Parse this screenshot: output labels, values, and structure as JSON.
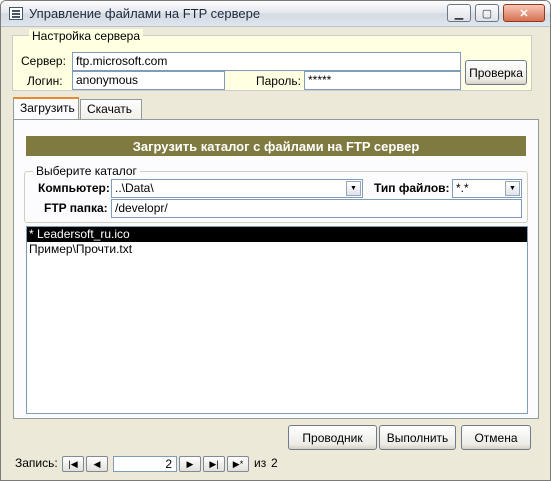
{
  "window": {
    "title": "Управление файлами на FTP сервере"
  },
  "settings": {
    "legend": "Настройка сервера",
    "server_label": "Сервер:",
    "server_value": "ftp.microsoft.com",
    "login_label": "Логин:",
    "login_value": "anonymous",
    "password_label": "Пароль:",
    "password_value": "*****",
    "check_button": "Проверка"
  },
  "tabs": [
    {
      "label": "Загрузить",
      "active": true
    },
    {
      "label": "Скачать",
      "active": false
    }
  ],
  "upload": {
    "banner": "Загрузить каталог с файлами на FTP сервер",
    "group_legend": "Выберите каталог",
    "computer_label": "Компьютер:",
    "computer_value": "..\\Data\\",
    "filetype_label": "Тип файлов:",
    "filetype_value": "*.*",
    "ftp_folder_label": "FTP папка:",
    "ftp_folder_value": "/developr/",
    "files": [
      {
        "name": "* Leadersoft_ru.ico",
        "selected": true
      },
      {
        "name": "Пример\\Прочти.txt",
        "selected": false
      }
    ]
  },
  "actions": {
    "explorer": "Проводник",
    "execute": "Выполнить",
    "cancel": "Отмена"
  },
  "record_nav": {
    "label": "Запись:",
    "current": "2",
    "of_label": "из",
    "total": "2"
  },
  "icons": [
    "app-icon",
    "minimize-icon",
    "maximize-icon",
    "close-icon",
    "chevron-down-icon",
    "first-record-icon",
    "prev-record-icon",
    "next-record-icon",
    "last-record-icon",
    "new-record-icon"
  ],
  "colors": {
    "banner": "#7f7a3f",
    "settings_bg": "#ffffe1",
    "selection": "#000000"
  }
}
